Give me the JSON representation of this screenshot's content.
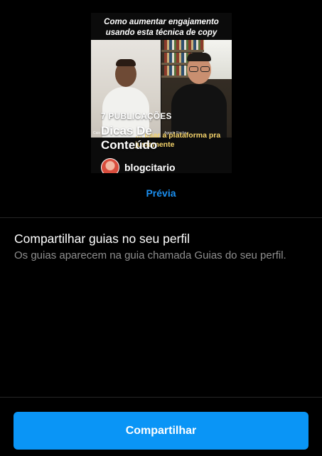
{
  "guide_cover": {
    "headline": "Como aumentar engajamento usando esta técnica de copy",
    "video_caption": "… usar a plataforma pra justamente",
    "participant_left": "Caio",
    "participant_right": "Agnelo Rocha",
    "count_label": "7 PUBLICAÇÕES",
    "title": "Dicas De Conteúdo",
    "author": {
      "username": "blogcitario",
      "avatar_icon": "profile-avatar"
    }
  },
  "preview_label": "Prévia",
  "share_section": {
    "heading": "Compartilhar guias no seu perfil",
    "description": "Os guias aparecem na guia chamada Guias do seu perfil."
  },
  "primary_action": {
    "label": "Compartilhar"
  },
  "colors": {
    "background": "#000000",
    "accent_blue": "#0a95f6",
    "link_blue": "#1b8ff0",
    "secondary_text": "#8e8e8e",
    "divider": "#262626",
    "caption_yellow": "#f5d36a"
  }
}
